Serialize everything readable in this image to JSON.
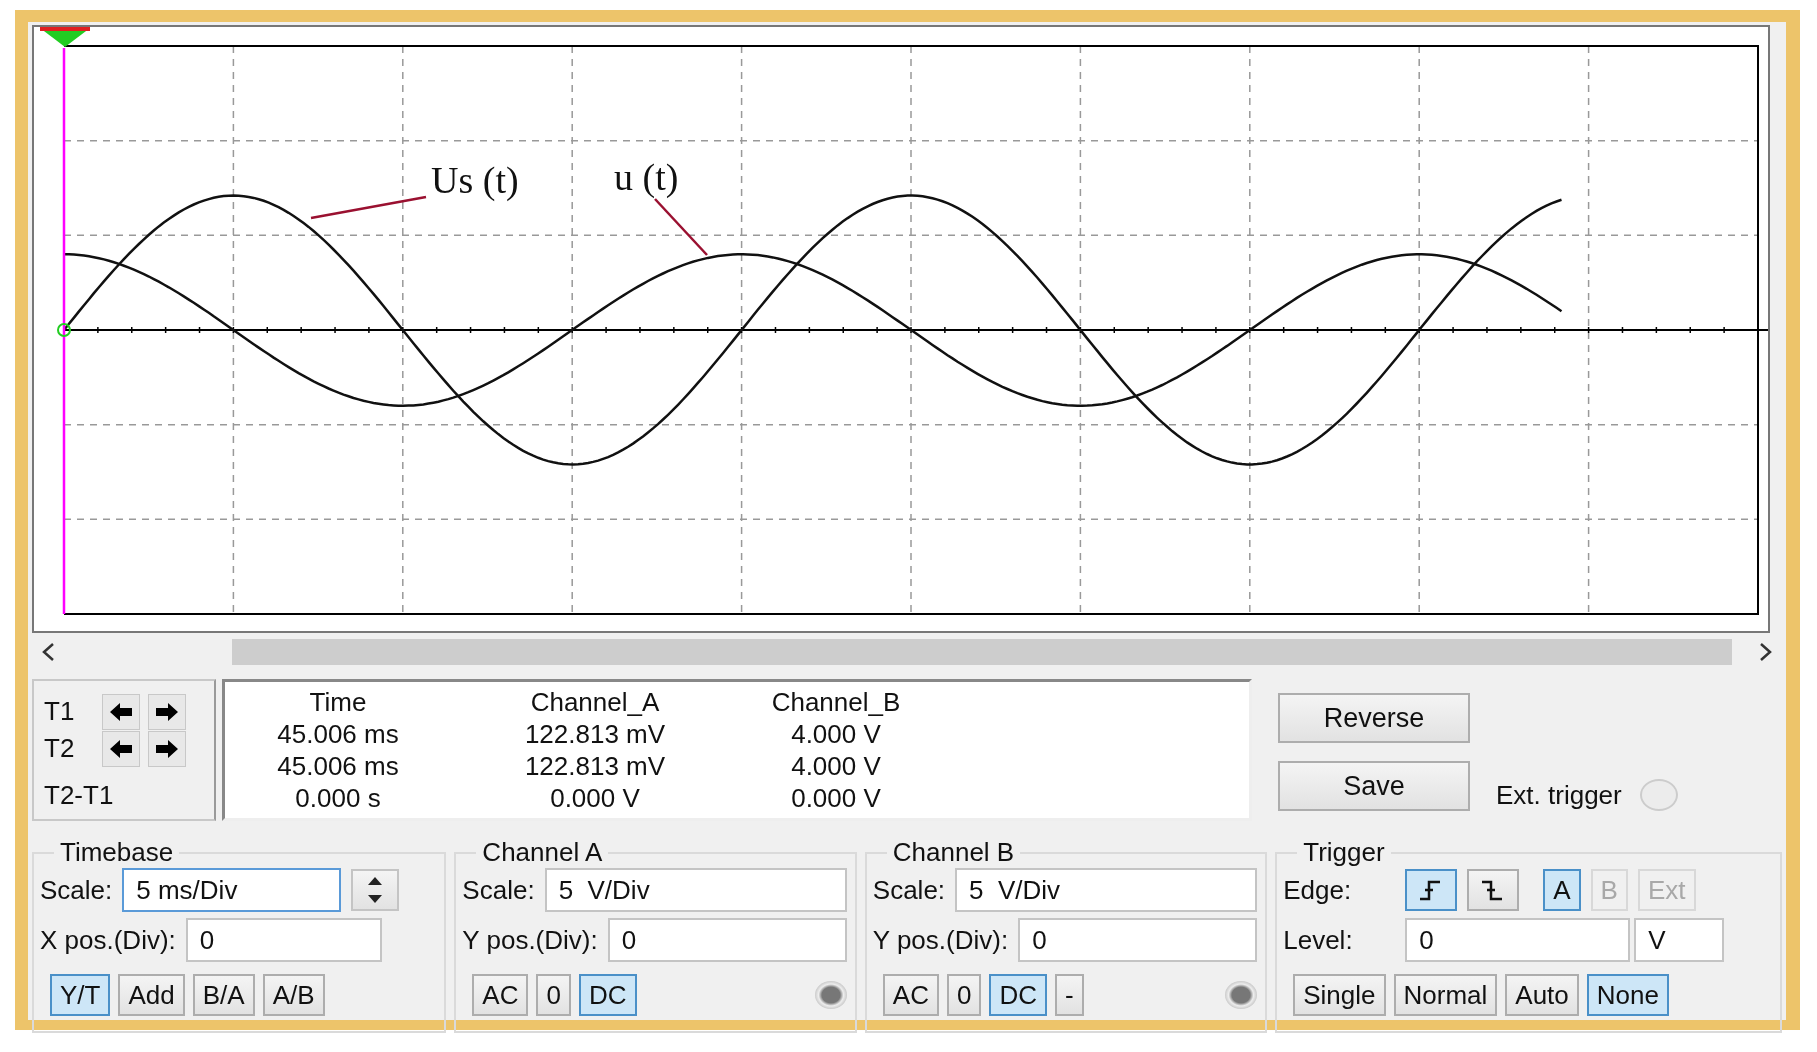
{
  "screen": {
    "trace_labels": [
      {
        "text": "Us (t)"
      },
      {
        "text": "u (t)"
      }
    ]
  },
  "cursors": [
    {
      "label": "T1",
      "kind": "arrows"
    },
    {
      "label": "T2",
      "kind": "arrows"
    },
    {
      "label": "T2-T1",
      "kind": "difference"
    }
  ],
  "readout": {
    "columns": [
      "Time",
      "Channel_A",
      "Channel_B"
    ],
    "rows": [
      [
        "45.006 ms",
        "122.813 mV",
        "4.000 V"
      ],
      [
        "45.006 ms",
        "122.813 mV",
        "4.000 V"
      ],
      [
        "0.000 s",
        "0.000 V",
        "0.000 V"
      ]
    ]
  },
  "buttons": [
    "Reverse",
    "Save"
  ],
  "ext_trigger": {
    "label": "Ext. trigger"
  },
  "timebase": {
    "title": "Timebase",
    "scale_label": "Scale:",
    "scale": "5 ms/Div",
    "focused": true,
    "xpos_label": "X pos.(Div):",
    "xpos": "0",
    "modes": [
      {
        "label": "Y/T",
        "selected": true
      },
      {
        "label": "Add",
        "selected": false
      },
      {
        "label": "B/A",
        "selected": false
      },
      {
        "label": "A/B",
        "selected": false
      }
    ]
  },
  "channels": [
    {
      "title": "Channel A",
      "scale_label": "Scale:",
      "scale": "5  V/Div",
      "ypos_label": "Y pos.(Div):",
      "ypos": "0",
      "coupling": [
        {
          "label": "AC",
          "selected": false
        },
        {
          "label": "0",
          "selected": false
        },
        {
          "label": "DC",
          "selected": true
        }
      ]
    },
    {
      "title": "Channel B",
      "scale_label": "Scale:",
      "scale": "5  V/Div",
      "ypos_label": "Y pos.(Div):",
      "ypos": "0",
      "coupling": [
        {
          "label": "AC",
          "selected": false
        },
        {
          "label": "0",
          "selected": false
        },
        {
          "label": "DC",
          "selected": true
        },
        {
          "label": "-",
          "selected": false
        }
      ]
    }
  ],
  "trigger": {
    "title": "Trigger",
    "edge_label": "Edge:",
    "edges": [
      {
        "kind": "rising",
        "selected": true
      },
      {
        "kind": "falling",
        "selected": false
      }
    ],
    "sources": [
      {
        "label": "A",
        "selected": true,
        "disabled": false
      },
      {
        "label": "B",
        "selected": false,
        "disabled": true
      },
      {
        "label": "Ext",
        "selected": false,
        "disabled": true
      }
    ],
    "level_label": "Level:",
    "level": "0",
    "level_unit": "V",
    "modes": [
      {
        "label": "Single",
        "selected": false
      },
      {
        "label": "Normal",
        "selected": false
      },
      {
        "label": "Auto",
        "selected": false
      },
      {
        "label": "None",
        "selected": true
      }
    ]
  }
}
